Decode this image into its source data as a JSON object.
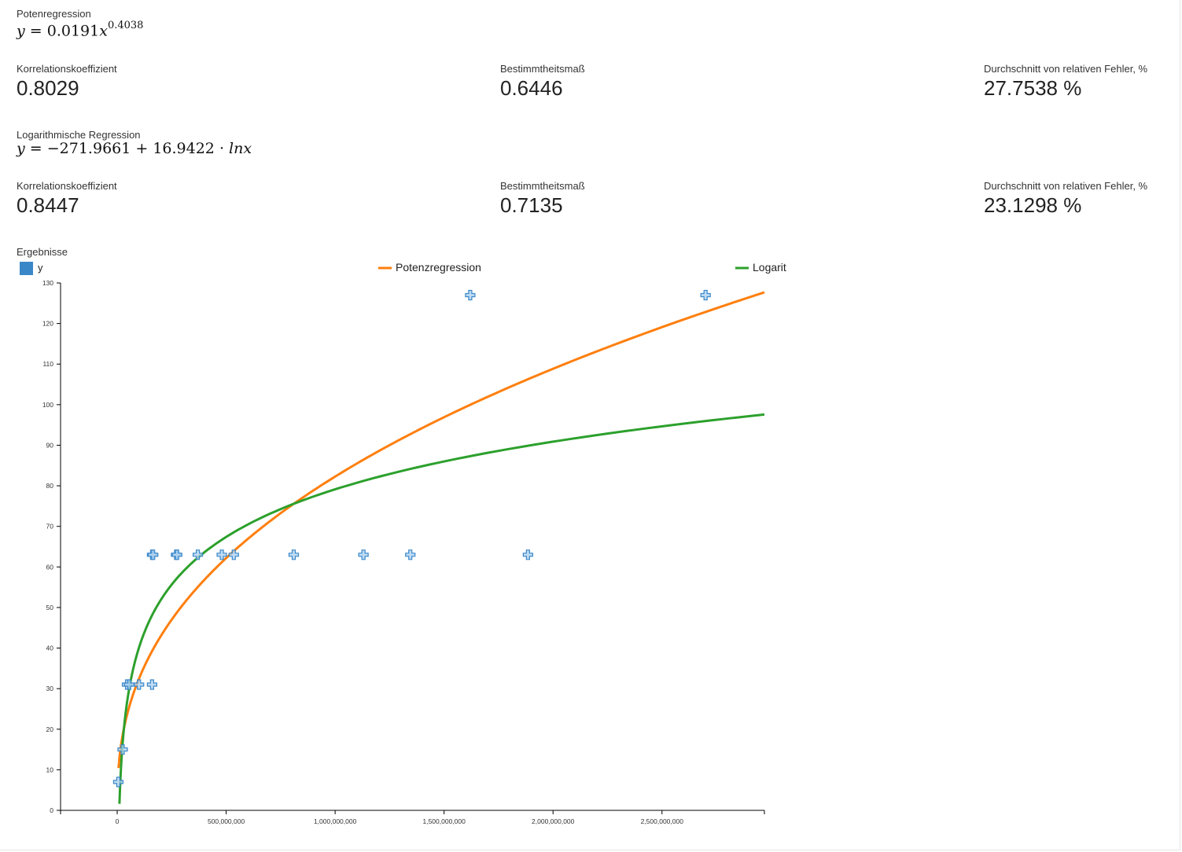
{
  "sections": [
    {
      "title": "Potenregression",
      "formula": {
        "lhs": "y",
        "coef": "0.0191",
        "var": "x",
        "exp": "0.4038"
      },
      "metrics": [
        {
          "label": "Korrelationskoeffizient",
          "value": "0.8029"
        },
        {
          "label": "Bestimmtheitsmaß",
          "value": "0.6446"
        },
        {
          "label": "Durchschnitt von relativen Fehler, %",
          "value": "27.7538 %"
        }
      ]
    },
    {
      "title": "Logarithmische Regression",
      "formula": {
        "lhs": "y",
        "intercept": "−271.9661",
        "slope": "16.9422",
        "fn": "ln",
        "var": "x"
      },
      "metrics": [
        {
          "label": "Korrelationskoeffizient",
          "value": "0.8447"
        },
        {
          "label": "Bestimmtheitsmaß",
          "value": "0.7135"
        },
        {
          "label": "Durchschnitt von relativen Fehler, %",
          "value": "23.1298 %"
        }
      ]
    }
  ],
  "chart_title": "Ergebnisse",
  "chart_data": {
    "type": "scatter",
    "title": "Ergebnisse",
    "xlabel": "",
    "ylabel": "",
    "xlim": [
      -260000000,
      2970000000
    ],
    "ylim": [
      0,
      130
    ],
    "x_ticks": [
      0,
      500000000,
      1000000000,
      1500000000,
      2000000000,
      2500000000
    ],
    "x_tick_labels": [
      "0",
      "500,000,000",
      "1,000,000,000",
      "1,500,000,000",
      "2,000,000,000",
      "2,500,000,000"
    ],
    "y_ticks": [
      0,
      10,
      20,
      30,
      40,
      50,
      60,
      70,
      80,
      90,
      100,
      110,
      120,
      130
    ],
    "legend_position": "top",
    "series": [
      {
        "name": "y",
        "kind": "points",
        "color": "#3a87c8",
        "points": [
          [
            5000000,
            7
          ],
          [
            25000000,
            15
          ],
          [
            45000000,
            31
          ],
          [
            55000000,
            31
          ],
          [
            100000000,
            31
          ],
          [
            160000000,
            31
          ],
          [
            160000000,
            63
          ],
          [
            165000000,
            63
          ],
          [
            270000000,
            63
          ],
          [
            275000000,
            63
          ],
          [
            370000000,
            63
          ],
          [
            480000000,
            63
          ],
          [
            535000000,
            63
          ],
          [
            810000000,
            63
          ],
          [
            1130000000,
            63
          ],
          [
            1345000000,
            63
          ],
          [
            1620000000,
            127
          ],
          [
            1885000000,
            63
          ],
          [
            2700000000,
            127
          ]
        ]
      },
      {
        "name": "Potenzregression",
        "kind": "power",
        "color": "#ff7f0e",
        "a": 0.0191,
        "b": 0.4038
      },
      {
        "name": "Logarithmische Regression",
        "kind": "log",
        "color": "#2ca02c",
        "a": -271.9661,
        "b": 16.9422
      }
    ]
  }
}
